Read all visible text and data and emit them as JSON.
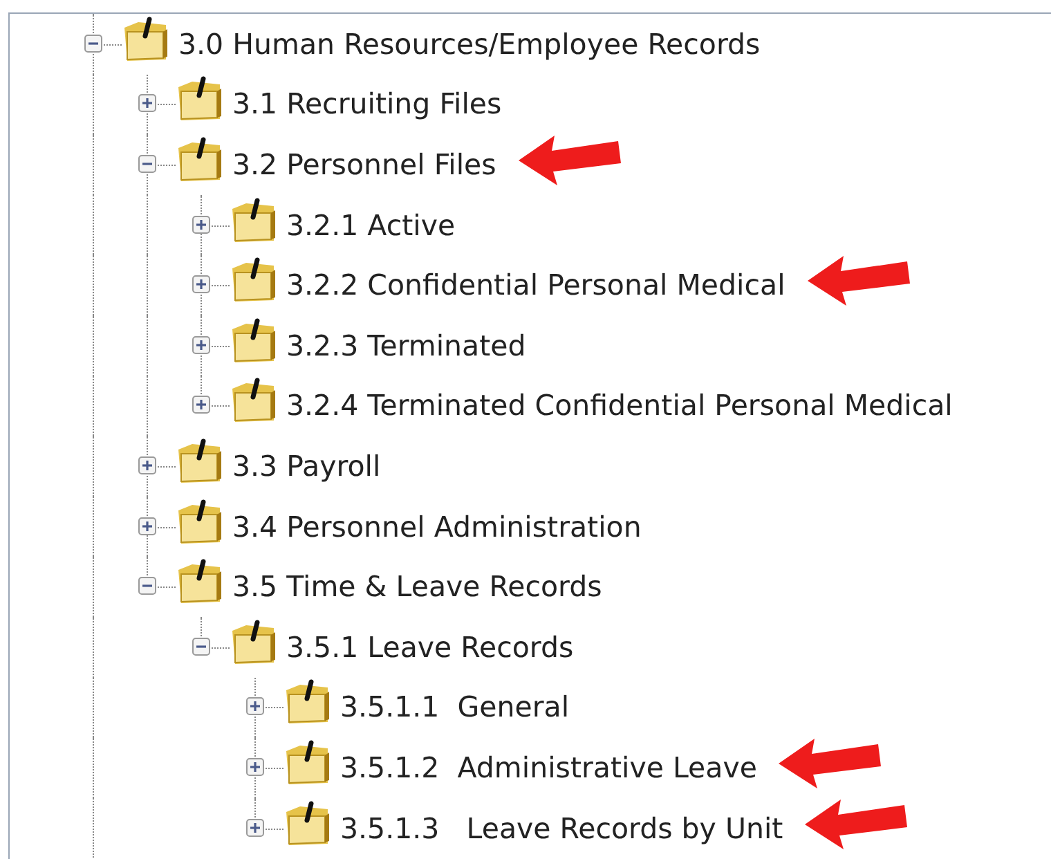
{
  "tree": [
    {
      "label": "3.0 Human Resources/Employee Records",
      "expanded": true,
      "marked": false,
      "children": [
        {
          "label": "3.1 Recruiting Files",
          "expanded": false,
          "marked": false
        },
        {
          "label": "3.2 Personnel Files",
          "expanded": true,
          "marked": true,
          "children": [
            {
              "label": "3.2.1 Active",
              "expanded": false,
              "marked": false
            },
            {
              "label": "3.2.2 Confidential Personal Medical",
              "expanded": false,
              "marked": true
            },
            {
              "label": "3.2.3 Terminated",
              "expanded": false,
              "marked": false
            },
            {
              "label": "3.2.4 Terminated Confidential Personal Medical",
              "expanded": false,
              "marked": false
            }
          ]
        },
        {
          "label": "3.3 Payroll",
          "expanded": false,
          "marked": false
        },
        {
          "label": "3.4 Personnel Administration",
          "expanded": false,
          "marked": false
        },
        {
          "label": "3.5 Time & Leave Records",
          "expanded": true,
          "marked": false,
          "children": [
            {
              "label": "3.5.1 Leave Records",
              "expanded": true,
              "marked": false,
              "children": [
                {
                  "label": "3.5.1.1  General",
                  "expanded": false,
                  "marked": false
                },
                {
                  "label": "3.5.1.2  Administrative Leave",
                  "expanded": false,
                  "marked": true
                },
                {
                  "label": "3.5.1.3   Leave Records by Unit",
                  "expanded": false,
                  "marked": true
                }
              ]
            }
          ]
        }
      ]
    }
  ]
}
